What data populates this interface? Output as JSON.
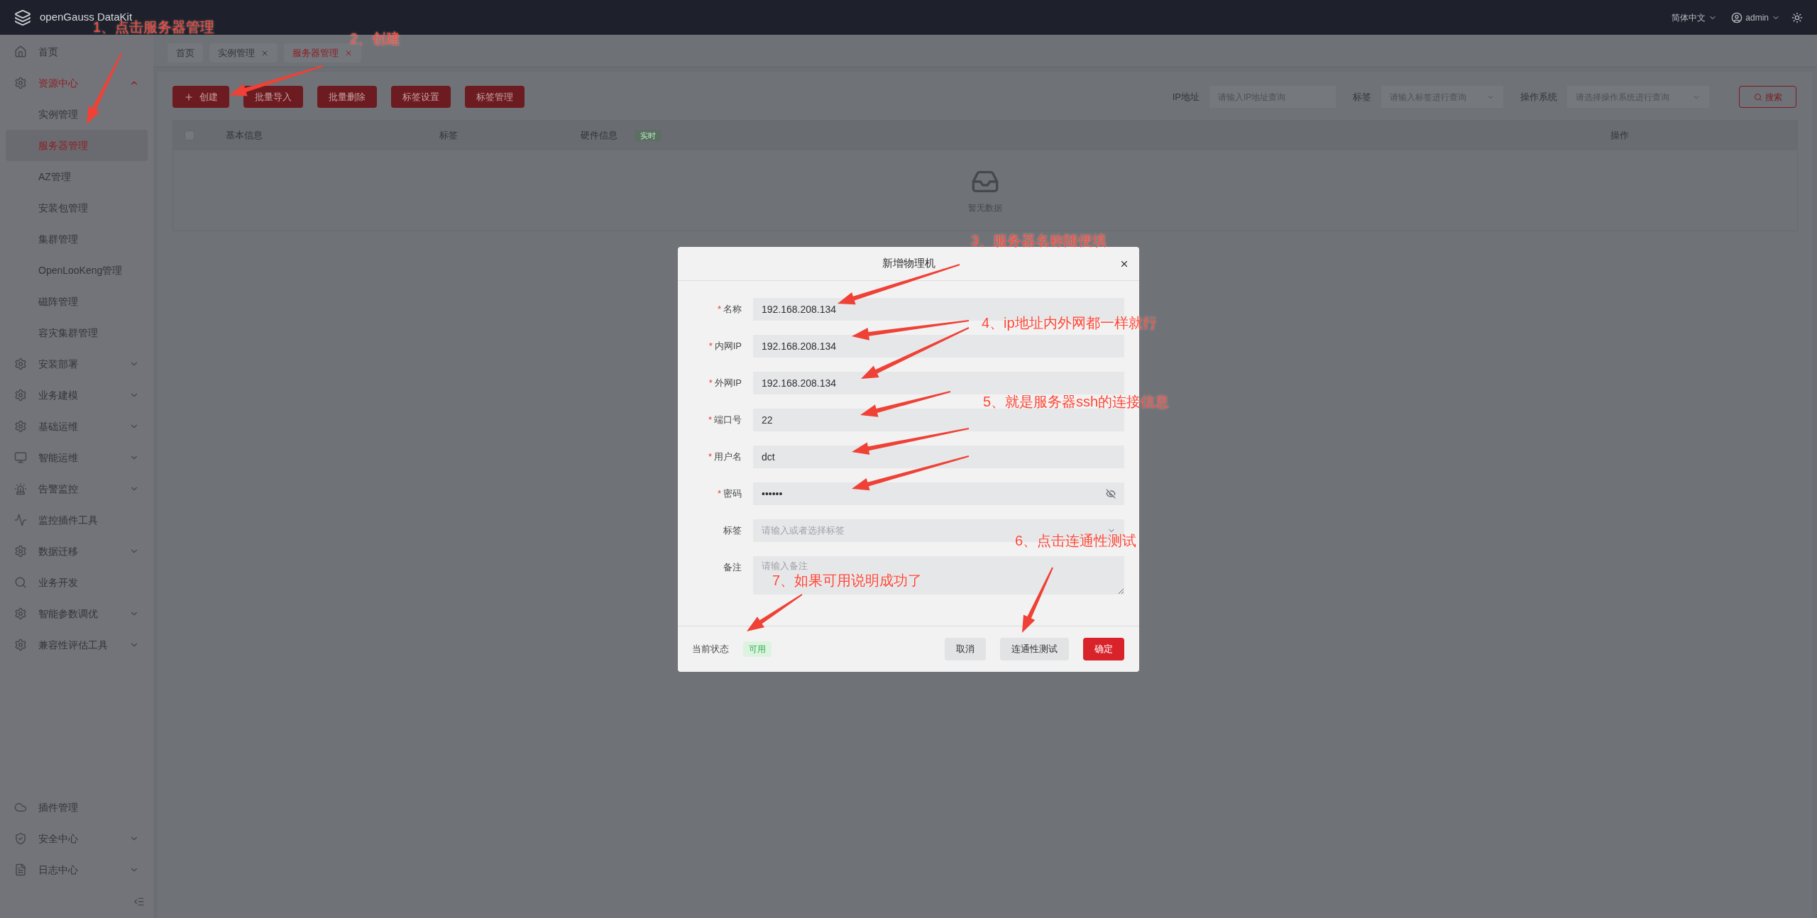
{
  "header": {
    "title": "openGauss DataKit",
    "language": "简体中文",
    "user": "admin"
  },
  "sidebar": {
    "items": [
      {
        "label": "首页",
        "selected": false
      },
      {
        "label": "资源中心",
        "selected": true,
        "expanded": true,
        "children": [
          {
            "label": "实例管理",
            "selected": false
          },
          {
            "label": "服务器管理",
            "selected": true
          },
          {
            "label": "AZ管理",
            "selected": false
          },
          {
            "label": "安装包管理",
            "selected": false
          },
          {
            "label": "集群管理",
            "selected": false
          },
          {
            "label": "OpenLooKeng管理",
            "selected": false
          },
          {
            "label": "磁阵管理",
            "selected": false
          },
          {
            "label": "容灾集群管理",
            "selected": false
          }
        ]
      },
      {
        "label": "安装部署",
        "selected": false,
        "expanded": false
      },
      {
        "label": "业务建模",
        "selected": false,
        "expanded": false
      },
      {
        "label": "基础运维",
        "selected": false,
        "expanded": false
      },
      {
        "label": "智能运维",
        "selected": false,
        "expanded": false
      },
      {
        "label": "告警监控",
        "selected": false,
        "expanded": false
      },
      {
        "label": "监控插件工具",
        "selected": false
      },
      {
        "label": "数据迁移",
        "selected": false,
        "expanded": false
      },
      {
        "label": "业务开发",
        "selected": false
      },
      {
        "label": "智能参数调优",
        "selected": false,
        "expanded": false
      },
      {
        "label": "兼容性评估工具",
        "selected": false,
        "expanded": false
      }
    ],
    "bottom_items": [
      {
        "label": "插件管理",
        "selected": false
      },
      {
        "label": "安全中心",
        "selected": false,
        "expanded": false
      },
      {
        "label": "日志中心",
        "selected": false,
        "expanded": false
      }
    ]
  },
  "tabs": [
    {
      "label": "首页",
      "selected": false,
      "closable": false
    },
    {
      "label": "实例管理",
      "selected": false,
      "closable": true
    },
    {
      "label": "服务器管理",
      "selected": true,
      "closable": true
    }
  ],
  "toolbar": {
    "buttons": [
      {
        "label": "创建",
        "kind": "create"
      },
      {
        "label": "批量导入",
        "kind": "plain"
      },
      {
        "label": "批量删除",
        "kind": "plain"
      },
      {
        "label": "标签设置",
        "kind": "plain"
      },
      {
        "label": "标签管理",
        "kind": "plain"
      }
    ]
  },
  "filters": [
    {
      "label": "IP地址",
      "placeholder": "请输入IP地址查询",
      "kind": "input"
    },
    {
      "label": "标签",
      "placeholder": "请输入标签进行查询",
      "kind": "select"
    },
    {
      "label": "操作系统",
      "placeholder": "请选择操作系统进行查询",
      "kind": "select"
    }
  ],
  "search_button": "搜索",
  "table": {
    "select_all": {
      "checked": false
    },
    "columns": [
      {
        "label": "基本信息"
      },
      {
        "label": "标签"
      },
      {
        "label": "硬件信息",
        "tag": "实时"
      },
      {
        "label": "操作"
      }
    ],
    "empty_text": "暂无数据"
  },
  "dialog": {
    "title": "新增物理机",
    "required_mark": "*",
    "fields": [
      {
        "label": "名称",
        "required": true,
        "kind": "text",
        "value": "192.168.208.134"
      },
      {
        "label": "内网IP",
        "required": true,
        "kind": "text",
        "value": "192.168.208.134"
      },
      {
        "label": "外网IP",
        "required": true,
        "kind": "text",
        "value": "192.168.208.134"
      },
      {
        "label": "端口号",
        "required": true,
        "kind": "text",
        "value": "22"
      },
      {
        "label": "用户名",
        "required": true,
        "kind": "text",
        "value": "dct"
      },
      {
        "label": "密码",
        "required": true,
        "kind": "password",
        "value": "••••••"
      },
      {
        "label": "标签",
        "required": false,
        "kind": "select",
        "placeholder": "请输入或者选择标签"
      },
      {
        "label": "备注",
        "required": false,
        "kind": "textarea",
        "placeholder": "请输入备注"
      }
    ],
    "status_label": "当前状态",
    "status": "可用",
    "buttons": [
      {
        "label": "取消",
        "kind": "secondary"
      },
      {
        "label": "连通性测试",
        "kind": "secondary"
      },
      {
        "label": "确定",
        "kind": "primary"
      }
    ]
  },
  "annotations": [
    {
      "text": "1、点击服务器管理"
    },
    {
      "text": "2、创建"
    },
    {
      "text": "3、服务器名称随便填"
    },
    {
      "text": "4、ip地址内外网都一样就行"
    },
    {
      "text": "5、就是服务器ssh的连接信息"
    },
    {
      "text": "6、点击连通性测试"
    },
    {
      "text": "7、如果可用说明成功了"
    }
  ]
}
